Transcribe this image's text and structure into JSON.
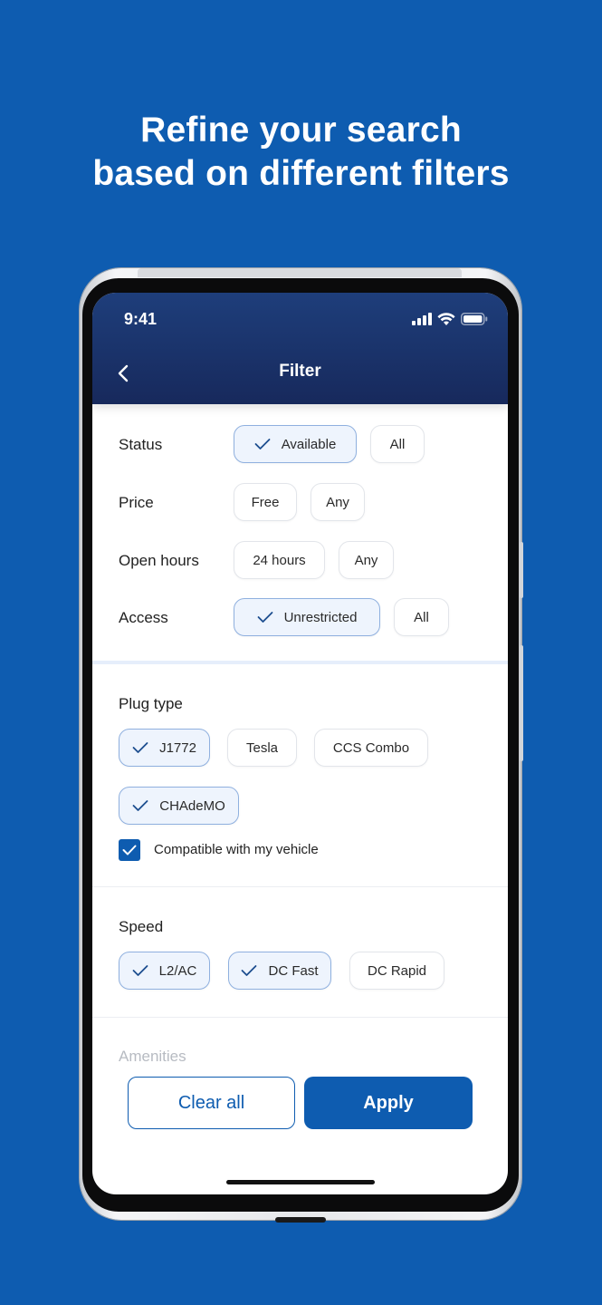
{
  "promo": {
    "headline_line1": "Refine your search",
    "headline_line2": "based on different filters"
  },
  "status_bar": {
    "time": "9:41",
    "icons": [
      "cellular-signal-icon",
      "wifi-icon",
      "battery-icon"
    ]
  },
  "header": {
    "title": "Filter",
    "back_icon": "chevron-left-icon"
  },
  "filters": {
    "status": {
      "label": "Status",
      "options": [
        {
          "label": "Available",
          "selected": true
        },
        {
          "label": "All",
          "selected": false
        }
      ]
    },
    "price": {
      "label": "Price",
      "options": [
        {
          "label": "Free",
          "selected": false
        },
        {
          "label": "Any",
          "selected": false
        }
      ]
    },
    "open_hours": {
      "label": "Open hours",
      "options": [
        {
          "label": "24 hours",
          "selected": false
        },
        {
          "label": "Any",
          "selected": false
        }
      ]
    },
    "access": {
      "label": "Access",
      "options": [
        {
          "label": "Unrestricted",
          "selected": true
        },
        {
          "label": "All",
          "selected": false
        }
      ]
    }
  },
  "plug_type": {
    "title": "Plug type",
    "options": [
      {
        "label": "J1772",
        "selected": true
      },
      {
        "label": "Tesla",
        "selected": false
      },
      {
        "label": "CCS Combo",
        "selected": false
      },
      {
        "label": "CHAdeMO",
        "selected": true
      }
    ],
    "compatible_label": "Compatible with my vehicle",
    "compatible_checked": true
  },
  "speed": {
    "title": "Speed",
    "options": [
      {
        "label": "L2/AC",
        "selected": true
      },
      {
        "label": "DC Fast",
        "selected": true
      },
      {
        "label": "DC Rapid",
        "selected": false
      }
    ]
  },
  "amenities": {
    "title": "Amenities"
  },
  "actions": {
    "clear_label": "Clear all",
    "apply_label": "Apply"
  },
  "colors": {
    "background": "#0e5cb0",
    "header": "#17295c",
    "accent": "#0e5cb0",
    "chip_selected_bg": "#eef4fd"
  }
}
